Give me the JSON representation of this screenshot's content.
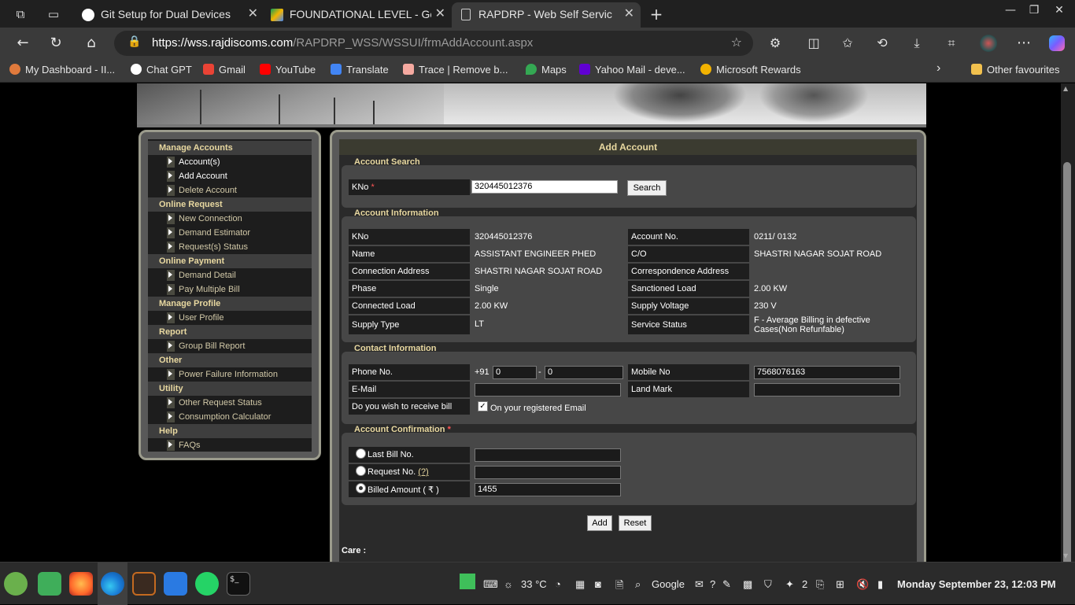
{
  "browser": {
    "tabs": [
      {
        "title": "Git Setup for Dual Devices",
        "icon": "chatgpt-icon"
      },
      {
        "title": "FOUNDATIONAL LEVEL - Goog",
        "icon": "google-drive-icon"
      },
      {
        "title": "RAPDRP - Web Self Service",
        "icon": "page-icon"
      }
    ],
    "url_host": "https://wss.rajdiscoms.com",
    "url_path": "/RAPDRP_WSS/WSSUI/frmAddAccount.aspx",
    "bookmarks": [
      {
        "label": "My Dashboard - II...",
        "color": "#e07a3c"
      },
      {
        "label": "Chat GPT",
        "color": "#ffffff"
      },
      {
        "label": "Gmail",
        "color": "#ea4335"
      },
      {
        "label": "YouTube",
        "color": "#ff0000"
      },
      {
        "label": "Translate",
        "color": "#4285f4"
      },
      {
        "label": "Trace | Remove b...",
        "color": "#f5a9a0"
      },
      {
        "label": "Maps",
        "color": "#34a853"
      },
      {
        "label": "Yahoo Mail - deve...",
        "color": "#6001d2"
      },
      {
        "label": "Microsoft Rewards",
        "color": "#f2b200"
      }
    ],
    "other_favourites": "Other favourites"
  },
  "sidebar": {
    "sections": [
      {
        "title": "Manage Accounts",
        "items": [
          "Account(s)",
          "Add Account",
          "Delete Account"
        ]
      },
      {
        "title": "Online Request",
        "items": [
          "New Connection",
          "Demand Estimator",
          "Request(s) Status"
        ]
      },
      {
        "title": "Online Payment",
        "items": [
          "Demand Detail",
          "Pay Multiple Bill"
        ]
      },
      {
        "title": "Manage Profile",
        "items": [
          "User Profile"
        ]
      },
      {
        "title": "Report",
        "items": [
          "Group Bill Report"
        ]
      },
      {
        "title": "Other",
        "items": [
          "Power Failure Information"
        ]
      },
      {
        "title": "Utility",
        "items": [
          "Other Request Status",
          "Consumption Calculator"
        ]
      },
      {
        "title": "Help",
        "items": [
          "FAQs"
        ]
      }
    ]
  },
  "main": {
    "title": "Add Account",
    "search": {
      "section_title": "Account Search",
      "kno_label": "KNo",
      "required_mark": "*",
      "kno_value": "320445012376",
      "search_button": "Search"
    },
    "info": {
      "section_title": "Account Information",
      "rows": [
        {
          "l1": "KNo",
          "v1": "320445012376",
          "l2": "Account No.",
          "v2": "0211/ 0132"
        },
        {
          "l1": "Name",
          "v1": "ASSISTANT ENGINEER PHED",
          "l2": "C/O",
          "v2": "SHASTRI NAGAR SOJAT ROAD"
        },
        {
          "l1": "Connection Address",
          "v1": "SHASTRI NAGAR SOJAT ROAD",
          "l2": "Correspondence Address",
          "v2": ""
        },
        {
          "l1": "Phase",
          "v1": "Single",
          "l2": "Sanctioned Load",
          "v2": "2.00 KW"
        },
        {
          "l1": "Connected Load",
          "v1": "2.00 KW",
          "l2": "Supply Voltage",
          "v2": "230 V"
        },
        {
          "l1": "Supply Type",
          "v1": "LT",
          "l2": "Service Status",
          "v2": "F - Average Billing in defective Cases(Non Refunfable)"
        }
      ]
    },
    "contact": {
      "section_title": "Contact Information",
      "phone_label": "Phone No.",
      "phone_prefix": "+91",
      "phone_std": "0",
      "phone_dash": "-",
      "phone_number": "0",
      "mobile_label": "Mobile No",
      "mobile_value": "7568076163",
      "email_label": "E-Mail",
      "email_value": "",
      "landmark_label": "Land Mark",
      "landmark_value": "",
      "bill_label": "Do you wish to receive bill",
      "bill_option": "On your registered Email",
      "bill_checked": true
    },
    "confirm": {
      "section_title": "Account Confirmation",
      "required_mark": "*",
      "options": [
        {
          "label": "Last Bill No.",
          "value": "",
          "selected": false
        },
        {
          "label": "Request No.",
          "help": "(?)",
          "value": "",
          "selected": false
        },
        {
          "label": "Billed Amount ( ₹ )",
          "value": "1455",
          "selected": true
        }
      ],
      "add_button": "Add",
      "reset_button": "Reset"
    },
    "care_label": "Care :"
  },
  "taskbar": {
    "weather": "33 °C",
    "search": "Google",
    "mail_badge": "?",
    "notif_count": "2",
    "clock": "Monday September 23, 12:03 PM"
  }
}
